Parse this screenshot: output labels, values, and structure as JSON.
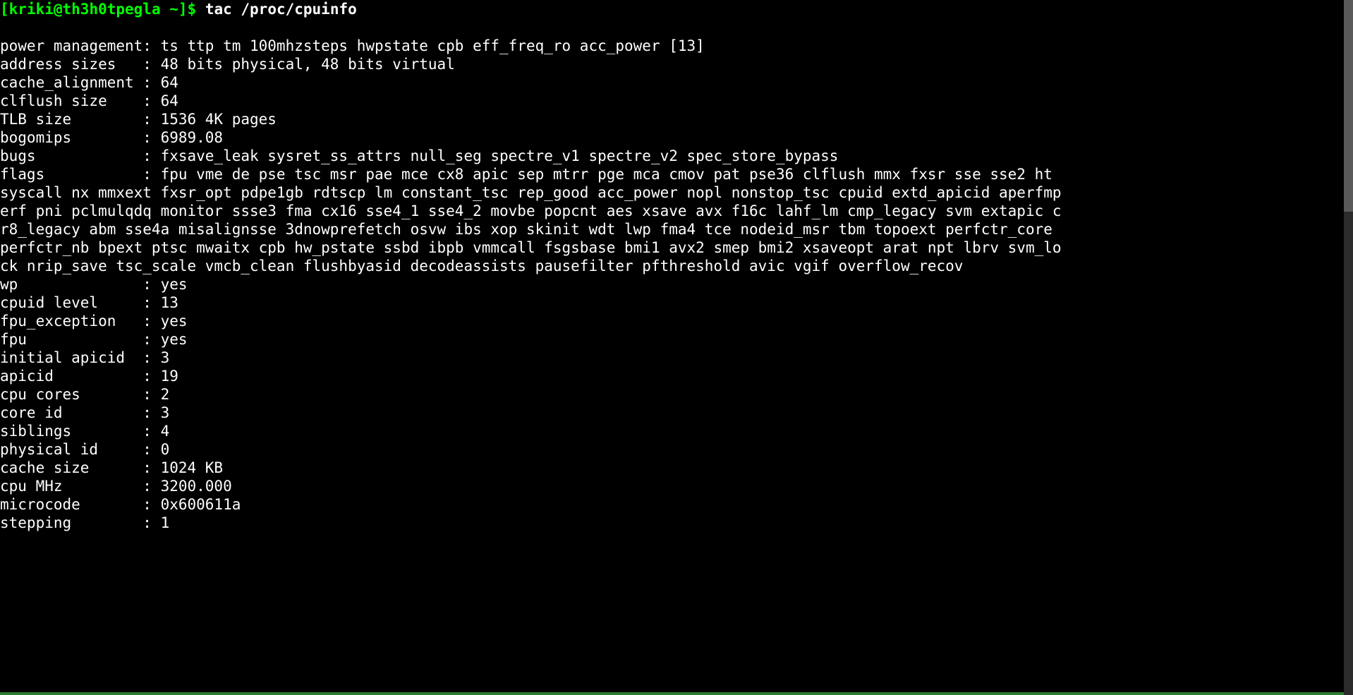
{
  "prompt": {
    "open": "[",
    "user": "kriki@th3h0tpegla ~",
    "close": "]$ ",
    "command": "tac /proc/cpuinfo"
  },
  "blank_line": "",
  "lines": {
    "l0": "power management: ts ttp tm 100mhzsteps hwpstate cpb eff_freq_ro acc_power [13]",
    "l1": "address sizes   : 48 bits physical, 48 bits virtual",
    "l2": "cache_alignment : 64",
    "l3": "clflush size    : 64",
    "l4": "TLB size        : 1536 4K pages",
    "l5": "bogomips        : 6989.08",
    "l6": "bugs            : fxsave_leak sysret_ss_attrs null_seg spectre_v1 spectre_v2 spec_store_bypass",
    "l7": "flags           : fpu vme de pse tsc msr pae mce cx8 apic sep mtrr pge mca cmov pat pse36 clflush mmx fxsr sse sse2 ht syscall nx mmxext fxsr_opt pdpe1gb rdtscp lm constant_tsc rep_good acc_power nopl nonstop_tsc cpuid extd_apicid aperfmperf pni pclmulqdq monitor ssse3 fma cx16 sse4_1 sse4_2 movbe popcnt aes xsave avx f16c lahf_lm cmp_legacy svm extapic cr8_legacy abm sse4a misalignsse 3dnowprefetch osvw ibs xop skinit wdt lwp fma4 tce nodeid_msr tbm topoext perfctr_core perfctr_nb bpext ptsc mwaitx cpb hw_pstate ssbd ibpb vmmcall fsgsbase bmi1 avx2 smep bmi2 xsaveopt arat npt lbrv svm_lock nrip_save tsc_scale vmcb_clean flushbyasid decodeassists pausefilter pfthreshold avic vgif overflow_recov",
    "l8": "wp              : yes",
    "l9": "cpuid level     : 13",
    "l10": "fpu_exception   : yes",
    "l11": "fpu             : yes",
    "l12": "initial apicid  : 3",
    "l13": "apicid          : 19",
    "l14": "cpu cores       : 2",
    "l15": "core id         : 3",
    "l16": "siblings        : 4",
    "l17": "physical id     : 0",
    "l18": "cache size      : 1024 KB",
    "l19": "cpu MHz         : 3200.000",
    "l20": "microcode       : 0x600611a",
    "l21": "stepping        : 1"
  }
}
